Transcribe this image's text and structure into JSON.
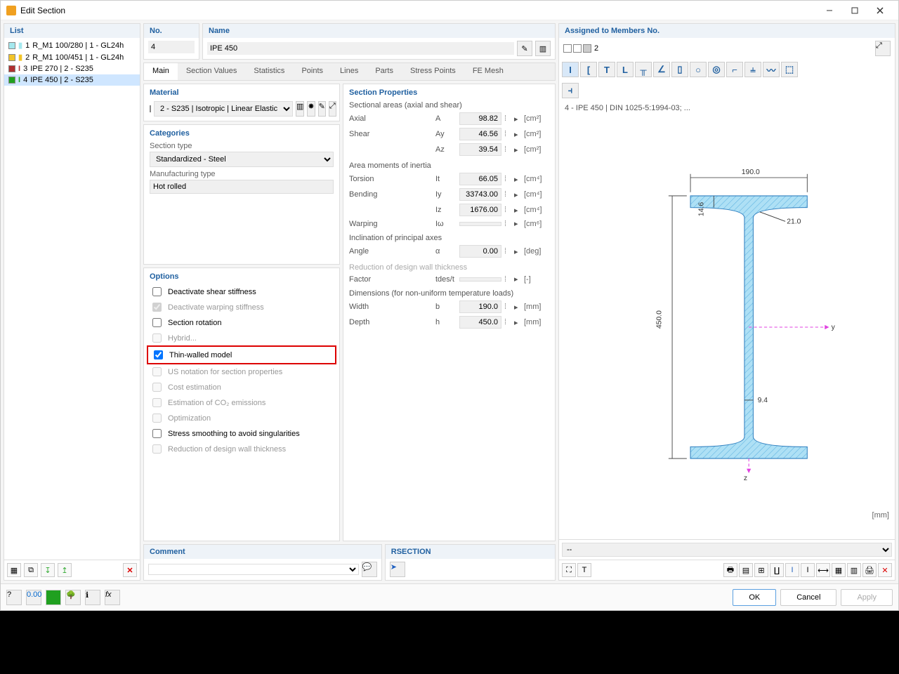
{
  "window": {
    "title": "Edit Section"
  },
  "list": {
    "header": "List",
    "items": [
      {
        "idx": "1",
        "label": "R_M1 100/280 | 1 - GL24h",
        "color": "#a4e8ee"
      },
      {
        "idx": "2",
        "label": "R_M1 100/451 | 1 - GL24h",
        "color": "#f2c428"
      },
      {
        "idx": "3",
        "label": "IPE 270 | 2 - S235",
        "color": "#b03030"
      },
      {
        "idx": "4",
        "label": "IPE 450 | 2 - S235",
        "color": "#20a020",
        "selected": true
      }
    ]
  },
  "fields": {
    "no_label": "No.",
    "no_value": "4",
    "name_label": "Name",
    "name_value": "IPE 450",
    "assigned_label": "Assigned to Members No.",
    "assigned_value": "2"
  },
  "tabs": [
    "Main",
    "Section Values",
    "Statistics",
    "Points",
    "Lines",
    "Parts",
    "Stress Points",
    "FE Mesh"
  ],
  "material": {
    "header": "Material",
    "value": "2 - S235 | Isotropic | Linear Elastic",
    "swatch": "#8a6a4a"
  },
  "categories": {
    "header": "Categories",
    "section_type_label": "Section type",
    "section_type_value": "Standardized - Steel",
    "manuf_label": "Manufacturing type",
    "manuf_value": "Hot rolled"
  },
  "options": {
    "header": "Options",
    "items": [
      {
        "label": "Deactivate shear stiffness",
        "checked": false,
        "enabled": true
      },
      {
        "label": "Deactivate warping stiffness",
        "checked": true,
        "enabled": false
      },
      {
        "label": "Section rotation",
        "checked": false,
        "enabled": true
      },
      {
        "label": "Hybrid...",
        "checked": false,
        "enabled": false
      },
      {
        "label": "Thin-walled model",
        "checked": true,
        "enabled": true,
        "highlight": true
      },
      {
        "label": "US notation for section properties",
        "checked": false,
        "enabled": false
      },
      {
        "label": "Cost estimation",
        "checked": false,
        "enabled": false
      },
      {
        "label": "Estimation of CO₂ emissions",
        "checked": false,
        "enabled": false
      },
      {
        "label": "Optimization",
        "checked": false,
        "enabled": false
      },
      {
        "label": "Stress smoothing to avoid singularities",
        "checked": false,
        "enabled": true
      },
      {
        "label": "Reduction of design wall thickness",
        "checked": false,
        "enabled": false
      }
    ]
  },
  "props": {
    "header": "Section Properties",
    "areas_label": "Sectional areas (axial and shear)",
    "axial": {
      "label": "Axial",
      "sym": "A",
      "val": "98.82",
      "unit": "[cm²]"
    },
    "shear_y": {
      "label": "Shear",
      "sym": "Ay",
      "val": "46.56",
      "unit": "[cm²]"
    },
    "shear_z": {
      "label": "",
      "sym": "Az",
      "val": "39.54",
      "unit": "[cm²]"
    },
    "inertia_label": "Area moments of inertia",
    "torsion": {
      "label": "Torsion",
      "sym": "It",
      "val": "66.05",
      "unit": "[cm⁴]"
    },
    "bending_y": {
      "label": "Bending",
      "sym": "Iy",
      "val": "33743.00",
      "unit": "[cm⁴]"
    },
    "bending_z": {
      "label": "",
      "sym": "Iz",
      "val": "1676.00",
      "unit": "[cm⁴]"
    },
    "warping": {
      "label": "Warping",
      "sym": "Iω",
      "val": "",
      "unit": "[cm⁶]"
    },
    "incl_label": "Inclination of principal axes",
    "angle": {
      "label": "Angle",
      "sym": "α",
      "val": "0.00",
      "unit": "[deg]"
    },
    "reduct_label": "Reduction of design wall thickness",
    "factor": {
      "label": "Factor",
      "sym": "tdes/t",
      "val": "",
      "unit": "[-]"
    },
    "dim_label": "Dimensions (for non-uniform temperature loads)",
    "width": {
      "label": "Width",
      "sym": "b",
      "val": "190.0",
      "unit": "[mm]"
    },
    "depth": {
      "label": "Depth",
      "sym": "h",
      "val": "450.0",
      "unit": "[mm]"
    }
  },
  "comment": {
    "header": "Comment",
    "value": ""
  },
  "rsection": {
    "header": "RSECTION"
  },
  "preview": {
    "title": "4 - IPE 450 | DIN 1025-5:1994-03; ...",
    "dims": {
      "width": "190.0",
      "depth": "450.0",
      "tf": "14.6",
      "tw": "9.4",
      "r": "21.0"
    },
    "unit": "[mm]",
    "dropdown": "--"
  },
  "buttons": {
    "ok": "OK",
    "cancel": "Cancel",
    "apply": "Apply"
  }
}
